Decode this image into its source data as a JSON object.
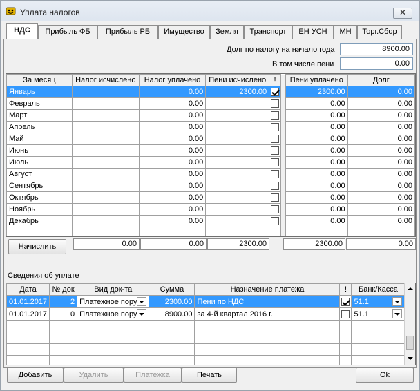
{
  "window": {
    "title": "Уплата налогов",
    "close_symbol": "✕"
  },
  "tabs": [
    "НДС",
    "Прибыль ФБ",
    "Прибыль РБ",
    "Имущество",
    "Земля",
    "Транспорт",
    "ЕН УСН",
    "МН",
    "Торг.Сбор"
  ],
  "debt": {
    "start_label": "Долг по налогу на начало года",
    "start_value": "8900.00",
    "penalty_label": "В том числе пени",
    "penalty_value": "0.00"
  },
  "monthly": {
    "headers": [
      "За месяц",
      "Налог исчислено",
      "Налог уплачено",
      "Пени исчислено",
      "!",
      "Пени уплачено",
      "Долг"
    ],
    "rows": [
      {
        "month": "Январь",
        "accrued": "",
        "paid": "0.00",
        "pen_accrued": "2300.00",
        "flag": true,
        "pen_paid": "2300.00",
        "debt": "0.00"
      },
      {
        "month": "Февраль",
        "accrued": "",
        "paid": "0.00",
        "pen_accrued": "",
        "flag": false,
        "pen_paid": "0.00",
        "debt": "0.00"
      },
      {
        "month": "Март",
        "accrued": "",
        "paid": "0.00",
        "pen_accrued": "",
        "flag": false,
        "pen_paid": "0.00",
        "debt": "0.00"
      },
      {
        "month": "Апрель",
        "accrued": "",
        "paid": "0.00",
        "pen_accrued": "",
        "flag": false,
        "pen_paid": "0.00",
        "debt": "0.00"
      },
      {
        "month": "Май",
        "accrued": "",
        "paid": "0.00",
        "pen_accrued": "",
        "flag": false,
        "pen_paid": "0.00",
        "debt": "0.00"
      },
      {
        "month": "Июнь",
        "accrued": "",
        "paid": "0.00",
        "pen_accrued": "",
        "flag": false,
        "pen_paid": "0.00",
        "debt": "0.00"
      },
      {
        "month": "Июль",
        "accrued": "",
        "paid": "0.00",
        "pen_accrued": "",
        "flag": false,
        "pen_paid": "0.00",
        "debt": "0.00"
      },
      {
        "month": "Август",
        "accrued": "",
        "paid": "0.00",
        "pen_accrued": "",
        "flag": false,
        "pen_paid": "0.00",
        "debt": "0.00"
      },
      {
        "month": "Сентябрь",
        "accrued": "",
        "paid": "0.00",
        "pen_accrued": "",
        "flag": false,
        "pen_paid": "0.00",
        "debt": "0.00"
      },
      {
        "month": "Октябрь",
        "accrued": "",
        "paid": "0.00",
        "pen_accrued": "",
        "flag": false,
        "pen_paid": "0.00",
        "debt": "0.00"
      },
      {
        "month": "Ноябрь",
        "accrued": "",
        "paid": "0.00",
        "pen_accrued": "",
        "flag": false,
        "pen_paid": "0.00",
        "debt": "0.00"
      },
      {
        "month": "Декабрь",
        "accrued": "",
        "paid": "0.00",
        "pen_accrued": "",
        "flag": false,
        "pen_paid": "0.00",
        "debt": "0.00"
      }
    ],
    "totals": {
      "accrued": "0.00",
      "paid": "0.00",
      "pen_accrued": "2300.00",
      "pen_paid": "2300.00",
      "debt": "0.00"
    }
  },
  "calc_button": "Начислить",
  "payments": {
    "section_label": "Сведения об уплате",
    "headers": [
      "Дата",
      "№ док",
      "Вид док-та",
      "Сумма",
      "Назначение платежа",
      "!",
      "Банк/Касса"
    ],
    "rows": [
      {
        "date": "01.01.2017",
        "num": "2",
        "doc_type": "Платежное пору",
        "sum": "2300.00",
        "purpose": "Пени по НДС",
        "flag": true,
        "bank": "51.1"
      },
      {
        "date": "01.01.2017",
        "num": "0",
        "doc_type": "Платежное пору",
        "sum": "8900.00",
        "purpose": "за 4-й квартал 2016 г.",
        "flag": false,
        "bank": "51.1"
      }
    ]
  },
  "buttons": {
    "add": "Добавить",
    "delete": "Удалить",
    "payments": "Платежка",
    "print": "Печать",
    "ok": "Ok"
  },
  "colors": {
    "selection": "#3399ff",
    "window_bg": "#f0f0f0"
  }
}
